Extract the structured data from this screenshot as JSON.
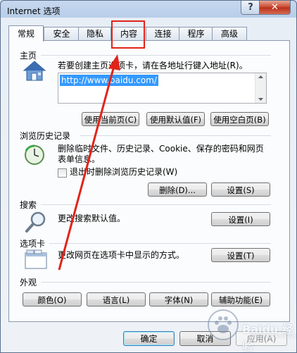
{
  "window": {
    "title": "Internet 选项"
  },
  "titlebar": {
    "help_glyph": "?",
    "close_glyph": "✕"
  },
  "tabs": [
    {
      "label": "常规",
      "active": true
    },
    {
      "label": "安全"
    },
    {
      "label": "隐私"
    },
    {
      "label": "内容"
    },
    {
      "label": "连接"
    },
    {
      "label": "程序"
    },
    {
      "label": "高级"
    }
  ],
  "home": {
    "title": "主页",
    "description": "若要创建主页选项卡，请在各地址行键入地址(R)。",
    "url": "http://www.baidu.com/",
    "buttons": [
      "使用当前页(C)",
      "使用默认值(F)",
      "使用空白页(B)"
    ]
  },
  "history": {
    "title": "浏览历史记录",
    "description_line1": "删除临时文件、历史记录、Cookie、保存的密码和网页",
    "description_line2": "表单信息。",
    "checkbox_label": "退出时删除浏览历史记录(W)",
    "delete_button": "删除(D)...",
    "settings_button": "设置(S)"
  },
  "search": {
    "title": "搜索",
    "description": "更改搜索默认值。",
    "settings_button": "设置(I)"
  },
  "tabs_section": {
    "title": "选项卡",
    "description": "更改网页在选项卡中显示的方式。",
    "settings_button": "设置(T)"
  },
  "appearance": {
    "title": "外观",
    "buttons": [
      "颜色(O)",
      "语言(L)",
      "字体(N)",
      "辅助功能(E)"
    ]
  },
  "footer": {
    "ok": "确定",
    "cancel": "取消",
    "apply": "应用(A)"
  },
  "watermark": {
    "brand": "Baidu 经验",
    "url": "jingyan.baidu.com"
  },
  "colors": {
    "annotation_red": "#e2231a",
    "selection_blue": "#3399ff"
  }
}
